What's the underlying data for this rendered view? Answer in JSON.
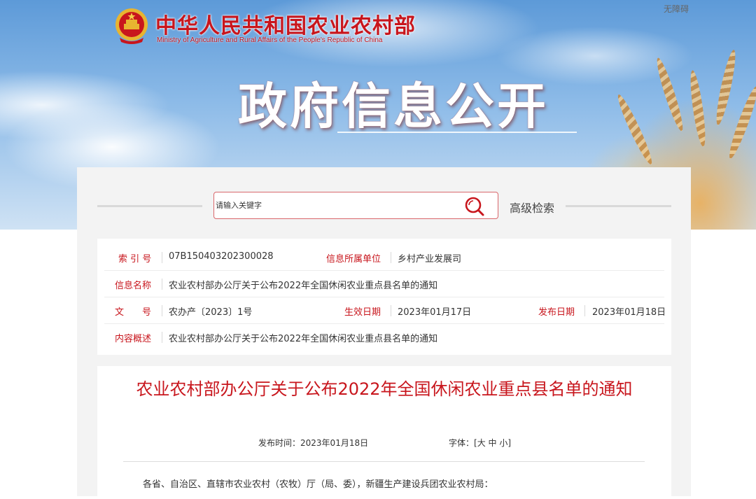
{
  "header": {
    "org_name_cn": "中华人民共和国农业农村部",
    "org_name_en": "Ministry of Agriculture and Rural Affairs of the People's Republic of China",
    "accessibility_link": "无障碍",
    "page_title": "政府信息公开"
  },
  "search": {
    "placeholder": "请输入关键字",
    "advanced_label": "高级检索"
  },
  "info": {
    "index_label": "索 引 号",
    "index_value": "07B150403202300028",
    "unit_label": "信息所属单位",
    "unit_value": "乡村产业发展司",
    "name_label": "信息名称",
    "name_value": "农业农村部办公厅关于公布2022年全国休闲农业重点县名单的通知",
    "doc_label": "文　　号",
    "doc_value": "农办产〔2023〕1号",
    "effective_label": "生效日期",
    "effective_value": "2023年01月17日",
    "publish_label": "发布日期",
    "publish_value": "2023年01月18日",
    "summary_label": "内容概述",
    "summary_value": "农业农村部办公厅关于公布2022年全国休闲农业重点县名单的通知"
  },
  "article": {
    "title": "农业农村部办公厅关于公布2022年全国休闲农业重点县名单的通知",
    "publish_time_label": "发布时间：",
    "publish_time_value": "2023年01月18日",
    "font_label": "字体：",
    "font_bracket_open": "[",
    "font_large": "大",
    "font_medium": "中",
    "font_small": "小",
    "font_bracket_close": "]",
    "salutation": "各省、自治区、直辖市农业农村（农牧）厅（局、委），新疆生产建设兵团农业农村局："
  },
  "colors": {
    "accent_red": "#c8161d",
    "panel_bg": "#f3f3f3",
    "sky_blue": "#8dbbe8"
  },
  "icons": {
    "emblem": "national-emblem-icon",
    "search": "search-icon"
  }
}
